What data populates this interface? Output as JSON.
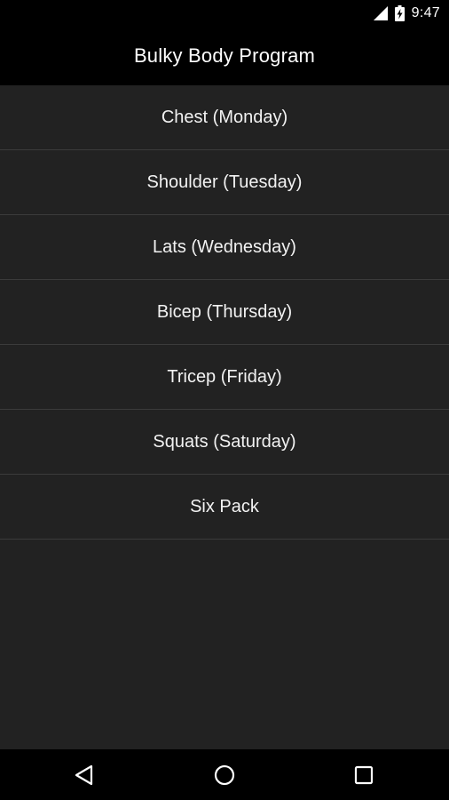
{
  "status_bar": {
    "time": "9:47",
    "icons": [
      "signal-icon",
      "battery-charging-icon"
    ]
  },
  "action_bar": {
    "title": "Bulky Body Program"
  },
  "program_list": {
    "items": [
      {
        "label": "Chest (Monday)"
      },
      {
        "label": "Shoulder (Tuesday)"
      },
      {
        "label": "Lats (Wednesday)"
      },
      {
        "label": "Bicep (Thursday)"
      },
      {
        "label": "Tricep (Friday)"
      },
      {
        "label": "Squats (Saturday)"
      },
      {
        "label": "Six Pack"
      }
    ]
  },
  "nav_bar": {
    "icons": [
      "back-icon",
      "home-icon",
      "recents-icon"
    ]
  },
  "colors": {
    "background": "#222222",
    "bars": "#000000",
    "divider": "#3b3b3b",
    "text": "#f2f2f2"
  }
}
